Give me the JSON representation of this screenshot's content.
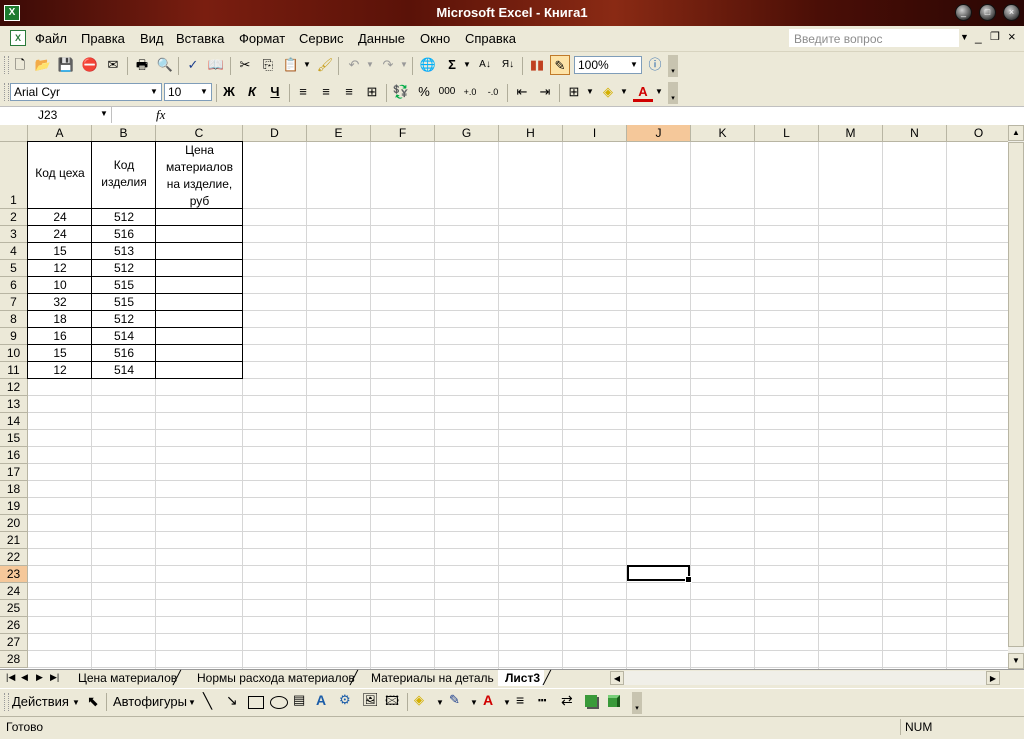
{
  "window": {
    "title": "Microsoft Excel - Книга1"
  },
  "menu": {
    "items": [
      "Файл",
      "Правка",
      "Вид",
      "Вставка",
      "Формат",
      "Сервис",
      "Данные",
      "Окно",
      "Справка"
    ],
    "help_placeholder": "Введите вопрос"
  },
  "toolbar": {
    "zoom": "100%"
  },
  "formatting": {
    "font": "Arial Cyr",
    "size": "10",
    "bold": "Ж",
    "italic": "К",
    "underline": "Ч",
    "percent": "%",
    "thousands": "000"
  },
  "formula": {
    "cell_ref": "J23",
    "fx": "fx"
  },
  "columns": [
    "A",
    "B",
    "C",
    "D",
    "E",
    "F",
    "G",
    "H",
    "I",
    "J",
    "K",
    "L",
    "M",
    "N",
    "O"
  ],
  "rows": [
    "1",
    "2",
    "3",
    "4",
    "5",
    "6",
    "7",
    "8",
    "9",
    "10",
    "11",
    "12",
    "13",
    "14",
    "15",
    "16",
    "17",
    "18",
    "19",
    "20",
    "21",
    "22",
    "23",
    "24",
    "25",
    "26",
    "27",
    "28"
  ],
  "table": {
    "header": {
      "a": "Код цеха",
      "b1": "Код",
      "b2": "изделия",
      "c1": "Цена",
      "c2": "материалов",
      "c3": "на изделие,",
      "c4": "руб"
    },
    "data": [
      [
        "24",
        "512"
      ],
      [
        "24",
        "516"
      ],
      [
        "15",
        "513"
      ],
      [
        "12",
        "512"
      ],
      [
        "10",
        "515"
      ],
      [
        "32",
        "515"
      ],
      [
        "18",
        "512"
      ],
      [
        "16",
        "514"
      ],
      [
        "15",
        "516"
      ],
      [
        "12",
        "514"
      ]
    ]
  },
  "sheets": [
    "Цена материалов",
    "Нормы расхода материалов",
    "Материалы на деталь",
    "Лист3"
  ],
  "drawing": {
    "actions": "Действия",
    "autoshapes": "Автофигуры"
  },
  "status": {
    "ready": "Готово",
    "num": "NUM"
  }
}
